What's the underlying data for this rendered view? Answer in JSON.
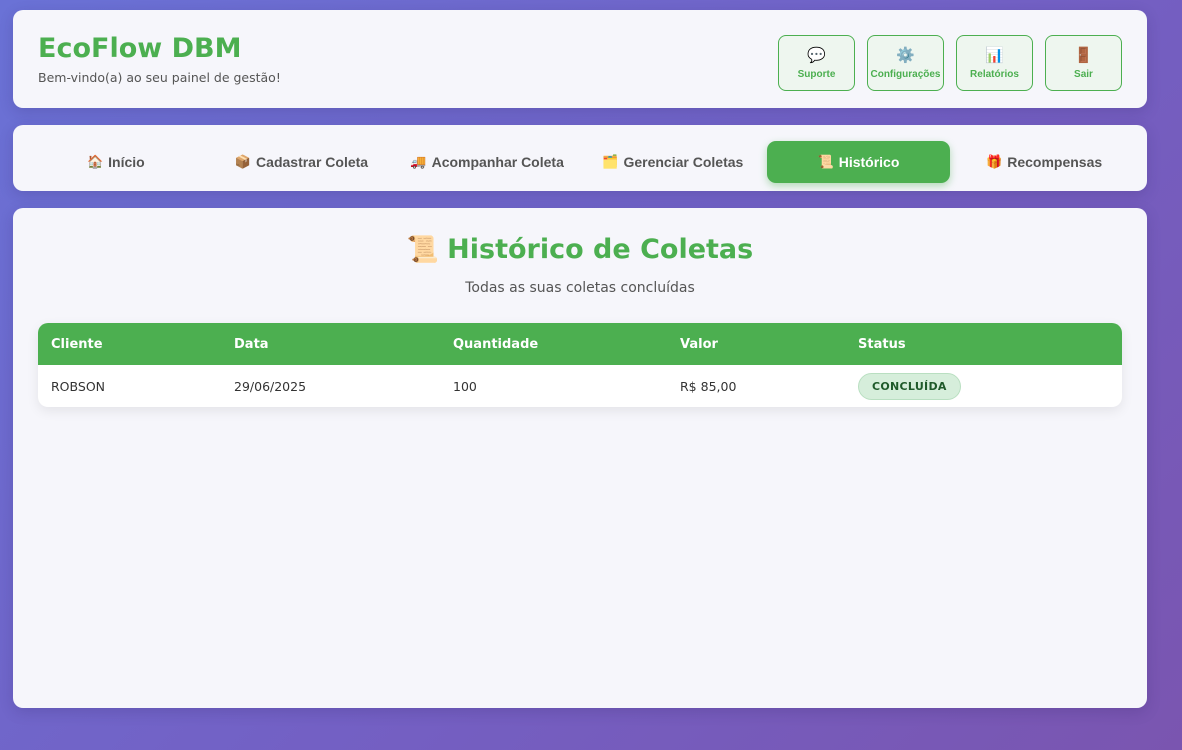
{
  "header": {
    "title": "EcoFlow DBM",
    "subtitle": "Bem-vindo(a) ao seu painel de gestão!",
    "actions": [
      {
        "icon": "💬",
        "icon_name": "speech-bubble-icon",
        "label": "Suporte"
      },
      {
        "icon": "⚙️",
        "icon_name": "gear-icon",
        "label": "Configurações"
      },
      {
        "icon": "📊",
        "icon_name": "bar-chart-icon",
        "label": "Relatórios"
      },
      {
        "icon": "🚪",
        "icon_name": "door-icon",
        "label": "Sair"
      }
    ]
  },
  "nav": {
    "tabs": [
      {
        "icon": "🏠",
        "label": "Início"
      },
      {
        "icon": "📦",
        "label": "Cadastrar Coleta"
      },
      {
        "icon": "🚚",
        "label": "Acompanhar Coleta"
      },
      {
        "icon": "🗂️",
        "label": "Gerenciar Coletas"
      },
      {
        "icon": "📜",
        "label": "Histórico"
      },
      {
        "icon": "🎁",
        "label": "Recompensas"
      }
    ],
    "active_index": 4
  },
  "main": {
    "title_icon": "📜",
    "title": "Histórico de Coletas",
    "subtitle": "Todas as suas coletas concluídas",
    "table": {
      "headers": [
        "Cliente",
        "Data",
        "Quantidade",
        "Valor",
        "Status"
      ],
      "rows": [
        {
          "cliente": "ROBSON",
          "data": "29/06/2025",
          "quantidade": "100",
          "valor": "R$ 85,00",
          "status": "CONCLUÍDA"
        }
      ]
    }
  },
  "colors": {
    "accent": "#4caf50",
    "badge_bg": "#d6eedb",
    "background_start": "#6a72d6",
    "background_end": "#7a55b0"
  }
}
